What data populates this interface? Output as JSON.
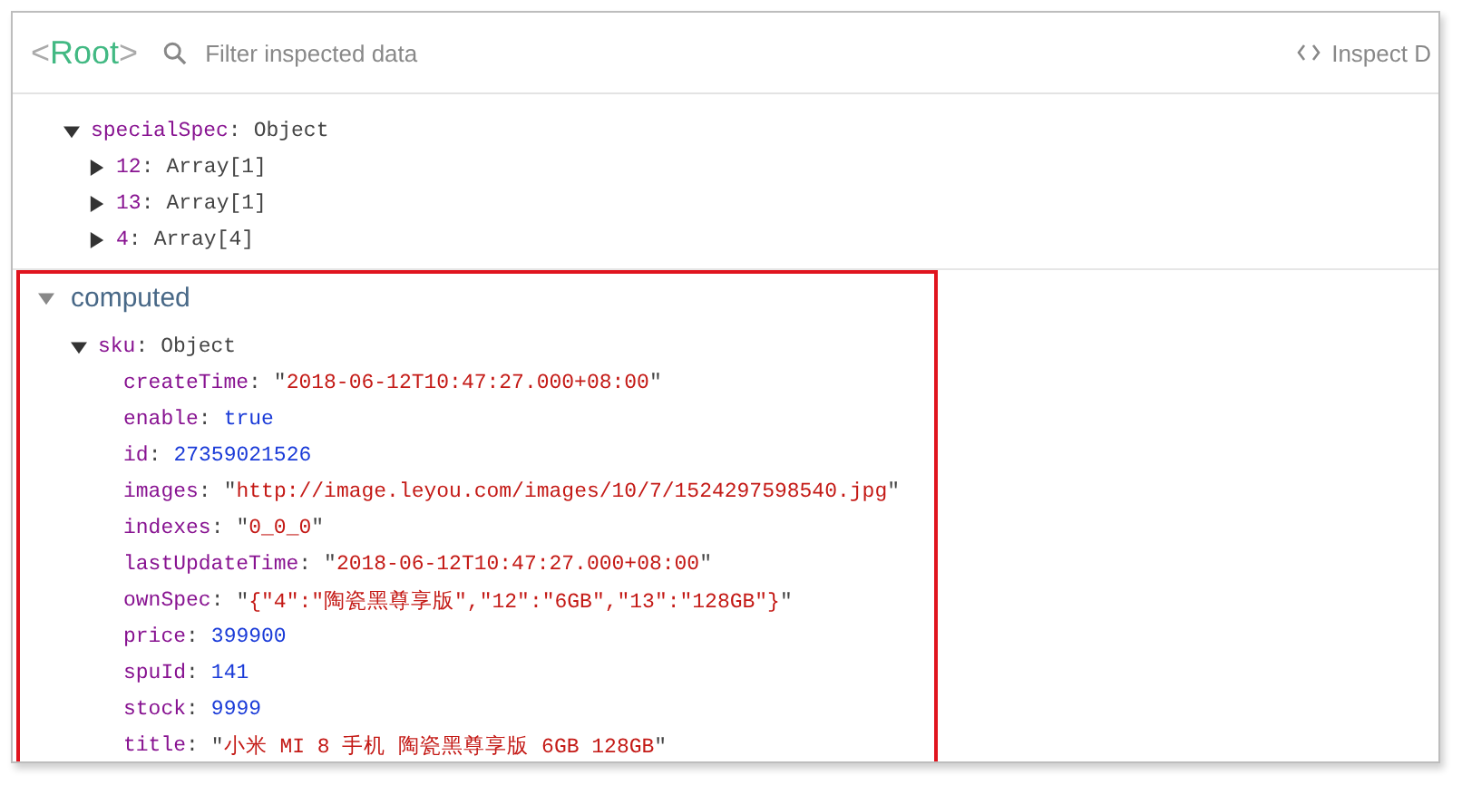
{
  "header": {
    "component": "<Root>",
    "search": {
      "placeholder": "Filter inspected data"
    },
    "inspect_button": "Inspect D"
  },
  "state_tree": [
    {
      "key": "specialSpec:",
      "value": "Object",
      "kind": "object",
      "expanded": true,
      "children": [
        {
          "key": "12:",
          "value": "Array[1]",
          "kind": "object",
          "expanded": false
        },
        {
          "key": "13:",
          "value": "Array[1]",
          "kind": "object",
          "expanded": false
        },
        {
          "key": "4:",
          "value": "Array[4]",
          "kind": "object",
          "expanded": false
        }
      ]
    }
  ],
  "computed": {
    "title": "computed",
    "expanded": true,
    "highlighted": true,
    "tree": [
      {
        "key": "sku:",
        "value": "Object",
        "kind": "object",
        "expanded": true,
        "children": [
          {
            "key": "createTime:",
            "value": "\"2018-06-12T10:47:27.000+08:00\"",
            "kind": "string"
          },
          {
            "key": "enable:",
            "value": "true",
            "kind": "literal"
          },
          {
            "key": "id:",
            "value": "27359021526",
            "kind": "literal"
          },
          {
            "key": "images:",
            "value": "\"http://image.leyou.com/images/10/7/1524297598540.jpg\"",
            "kind": "string"
          },
          {
            "key": "indexes:",
            "value": "\"0_0_0\"",
            "kind": "string"
          },
          {
            "key": "lastUpdateTime:",
            "value": "\"2018-06-12T10:47:27.000+08:00\"",
            "kind": "string"
          },
          {
            "key": "ownSpec:",
            "value": "\"{\"4\":\"陶瓷黑尊享版\",\"12\":\"6GB\",\"13\":\"128GB\"}\"",
            "kind": "string"
          },
          {
            "key": "price:",
            "value": "399900",
            "kind": "literal"
          },
          {
            "key": "spuId:",
            "value": "141",
            "kind": "literal"
          },
          {
            "key": "stock:",
            "value": "9999",
            "kind": "literal"
          },
          {
            "key": "title:",
            "value": "\"小米 MI 8 手机 陶瓷黑尊享版 6GB 128GB\"",
            "kind": "string"
          }
        ]
      }
    ]
  }
}
